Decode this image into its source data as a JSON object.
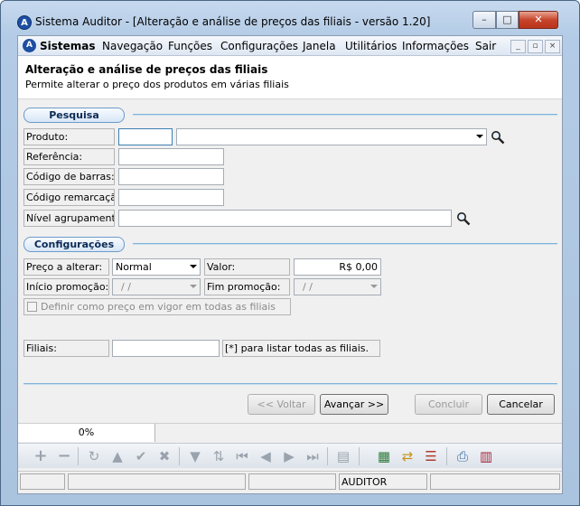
{
  "window": {
    "title": "Sistema Auditor - [Alteração e análise de preços das filiais - versão 1.20]",
    "min": "–",
    "max": "□",
    "close": "✕"
  },
  "menubar": {
    "items": [
      "Sistemas",
      "Navegação",
      "Funções",
      "Configurações",
      "Janela",
      "Utilitários",
      "Informações",
      "Sair"
    ],
    "mdi": [
      "_",
      "▫",
      "×"
    ]
  },
  "header": {
    "title": "Alteração e análise de preços das filiais",
    "subtitle": "Permite alterar o preço dos produtos em várias filiais"
  },
  "pesquisa": {
    "section": "Pesquisa",
    "produto_label": "Produto:",
    "produto_code": "",
    "produto_desc": "",
    "referencia_label": "Referência:",
    "referencia_value": "",
    "barras_label": "Código de barras:",
    "barras_value": "",
    "remarcacao_label": "Código remarcação:",
    "remarcacao_value": "",
    "nivel_label": "Nível agrupamento",
    "nivel_value": ""
  },
  "config": {
    "section": "Configurações",
    "preco_label": "Preço a alterar:",
    "preco_value": "Normal",
    "valor_label": "Valor:",
    "valor_value": "R$ 0,00",
    "inicio_label": "Início promoção:",
    "inicio_value": "/ /",
    "fim_label": "Fim promoção:",
    "fim_value": "/ /",
    "definir_label": "Definir como preço em vigor em todas as filiais",
    "definir_checked": false,
    "filiais_label": "Filiais:",
    "filiais_value": "",
    "filiais_hint": "[*] para listar todas as filiais."
  },
  "buttons": {
    "voltar": "<< Voltar",
    "avancar": "Avançar >>",
    "concluir": "Concluir",
    "cancelar": "Cancelar"
  },
  "progress": {
    "label": "0%",
    "value": 0
  },
  "toolbar": {
    "icons": [
      "add-icon",
      "remove-icon",
      "refresh-icon",
      "up-icon",
      "confirm-icon",
      "cancel-icon",
      "filter-icon",
      "sort-icon",
      "first-icon",
      "prev-icon",
      "next-icon",
      "last-icon",
      "export-icon",
      "import-icon",
      "transfer-icon",
      "list-icon",
      "print-icon",
      "calendar-icon"
    ]
  },
  "status": {
    "user": "AUDITOR"
  }
}
